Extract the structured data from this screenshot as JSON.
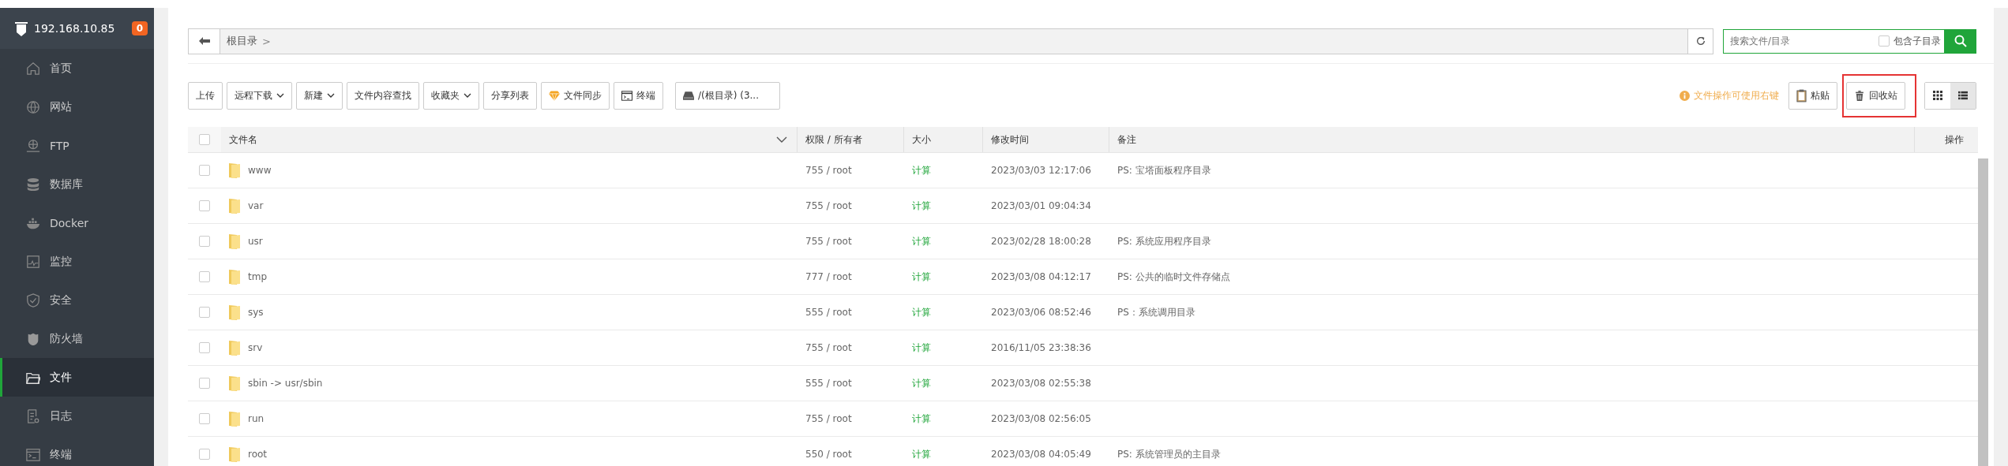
{
  "sidebar": {
    "host": "192.168.10.85",
    "badge": "0",
    "items": [
      {
        "label": "首页",
        "kind": "home",
        "selected": false
      },
      {
        "label": "网站",
        "kind": "globe",
        "selected": false
      },
      {
        "label": "FTP",
        "kind": "ftp",
        "selected": false
      },
      {
        "label": "数据库",
        "kind": "database",
        "selected": false
      },
      {
        "label": "Docker",
        "kind": "docker",
        "selected": false
      },
      {
        "label": "监控",
        "kind": "monitor",
        "selected": false
      },
      {
        "label": "安全",
        "kind": "shield",
        "selected": false
      },
      {
        "label": "防火墙",
        "kind": "firewall",
        "selected": false
      },
      {
        "label": "文件",
        "kind": "folder",
        "selected": true
      },
      {
        "label": "日志",
        "kind": "log",
        "selected": false
      },
      {
        "label": "终端",
        "kind": "terminal",
        "selected": false
      }
    ]
  },
  "breadcrumb": {
    "path": "根目录",
    "separator": ">"
  },
  "search": {
    "placeholder": "搜索文件/目录",
    "include_subdirs": {
      "label": "包含子目录",
      "checked": false
    }
  },
  "toolbar": [
    {
      "label": "上传",
      "kind": "plain"
    },
    {
      "label": "远程下载",
      "kind": "dropdown"
    },
    {
      "label": "新建",
      "kind": "dropdown"
    },
    {
      "label": "文件内容查找",
      "kind": "plain"
    },
    {
      "label": "收藏夹",
      "kind": "dropdown"
    },
    {
      "label": "分享列表",
      "kind": "plain"
    },
    {
      "label": "文件同步",
      "kind": "gem"
    },
    {
      "label": "终端",
      "kind": "terminal"
    },
    {
      "label": "/(根目录) (3...",
      "kind": "disk"
    }
  ],
  "hint": "文件操作可使用右键",
  "right_buttons": [
    {
      "label": "粘贴",
      "kind": "clipboard",
      "highlighted": false
    },
    {
      "label": "回收站",
      "kind": "trash",
      "highlighted": true
    }
  ],
  "view_modes": [
    {
      "kind": "grid",
      "selected": false
    },
    {
      "kind": "list",
      "selected": true
    }
  ],
  "table": {
    "select_all_checked": false,
    "columns": [
      "文件名",
      "权限 / 所有者",
      "大小",
      "修改时间",
      "备注",
      "操作"
    ],
    "rows": [
      {
        "name": "www",
        "perm": "755 / root",
        "size": "计算",
        "mtime": "2023/03/03 12:17:06",
        "note": "PS: 宝塔面板程序目录",
        "checked": false
      },
      {
        "name": "var",
        "perm": "755 / root",
        "size": "计算",
        "mtime": "2023/03/01 09:04:34",
        "note": "",
        "checked": false
      },
      {
        "name": "usr",
        "perm": "755 / root",
        "size": "计算",
        "mtime": "2023/02/28 18:00:28",
        "note": "PS: 系统应用程序目录",
        "checked": false
      },
      {
        "name": "tmp",
        "perm": "777 / root",
        "size": "计算",
        "mtime": "2023/03/08 04:12:17",
        "note": "PS: 公共的临时文件存储点",
        "checked": false
      },
      {
        "name": "sys",
        "perm": "555 / root",
        "size": "计算",
        "mtime": "2023/03/06 08:52:46",
        "note": "PS：系统调用目录",
        "checked": false
      },
      {
        "name": "srv",
        "perm": "755 / root",
        "size": "计算",
        "mtime": "2016/11/05 23:38:36",
        "note": "",
        "checked": false
      },
      {
        "name": "sbin -> usr/sbin",
        "perm": "555 / root",
        "size": "计算",
        "mtime": "2023/03/08 02:55:38",
        "note": "",
        "checked": false
      },
      {
        "name": "run",
        "perm": "755 / root",
        "size": "计算",
        "mtime": "2023/03/08 02:56:05",
        "note": "",
        "checked": false
      },
      {
        "name": "root",
        "perm": "550 / root",
        "size": "计算",
        "mtime": "2023/03/08 04:05:49",
        "note": "PS: 系统管理员的主目录",
        "checked": false
      }
    ]
  }
}
